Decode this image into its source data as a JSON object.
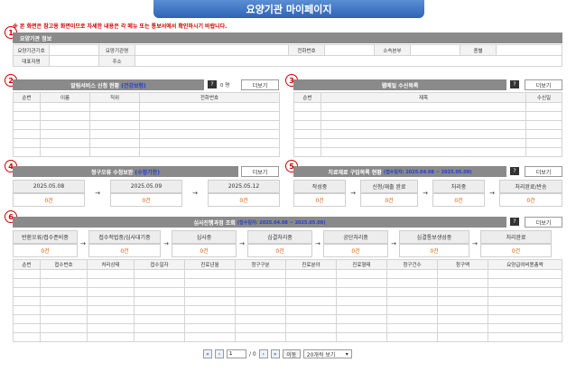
{
  "page_title": "요양기관 마이페이지",
  "notice": "※ 본 화면은 참고용 화면이므로 자세한 내용은 각 메뉴 또는 통보서에서 확인하시기 바랍니다.",
  "section_numbers": [
    "1",
    "2",
    "3",
    "4",
    "5",
    "6"
  ],
  "info": {
    "header": "요양기관 정보",
    "labels": [
      "요양기관기호",
      "요양기관명",
      "전화번호",
      "소속본부",
      "종별",
      "대표자명",
      "주소"
    ]
  },
  "alarm": {
    "title": "알림서비스 신청 현황",
    "title_blue": "(건강보험)",
    "count": "0 명",
    "help": "?",
    "more": "더보기",
    "columns": [
      "순번",
      "이름",
      "직위",
      "전화번호"
    ]
  },
  "doc": {
    "title": "웹메일 수신목록",
    "help": "?",
    "more": "더보기",
    "columns": [
      "순번",
      "제목",
      "수신일"
    ]
  },
  "error": {
    "title": "청구오류 수정보완",
    "title_blue": "(수정기한)",
    "more": "더보기",
    "dates": [
      "2025.05.08",
      "2025.05.09",
      "2025.05.12"
    ],
    "values": [
      "0건",
      "0건",
      "0건"
    ],
    "arrow": "→"
  },
  "treatment": {
    "title": "치료재료 구입목록 현황",
    "title_blue": "(접수일자: 2025.04.08 ~ 2025.05.08)",
    "help": "?",
    "more": "더보기",
    "steps": [
      "작성중",
      "신청/재출 완료",
      "처리중",
      "처리완료/반송"
    ],
    "values": [
      "0건",
      "0건",
      "0건",
      "0건"
    ],
    "arrow": "→"
  },
  "review": {
    "title": "심사진행과정 조회",
    "title_blue": "(접수일자: 2025.04.08 ~ 2025.05.08)",
    "help": "?",
    "more": "더보기",
    "steps": [
      "반환오류/접수준비중",
      "접수적법중/심사대기중",
      "심사중",
      "심결처리중",
      "공단처리중",
      "심결통보생성중",
      "처리완료"
    ],
    "values": [
      "0건",
      "0건",
      "0건",
      "0건",
      "0건",
      "0건",
      "0건"
    ],
    "arrow": "→",
    "columns": [
      "순번",
      "접수번호",
      "처리상태",
      "접수일자",
      "진료년월",
      "청구구분",
      "진료분야",
      "진료형태",
      "청구건수",
      "청구액",
      "요양급여비용총액"
    ]
  },
  "pager": {
    "first": "«",
    "prev": "‹",
    "page_value": "1",
    "total": "/ 0",
    "next": "›",
    "last": "»",
    "go": "이동",
    "per_page": "20개씩 보기"
  }
}
